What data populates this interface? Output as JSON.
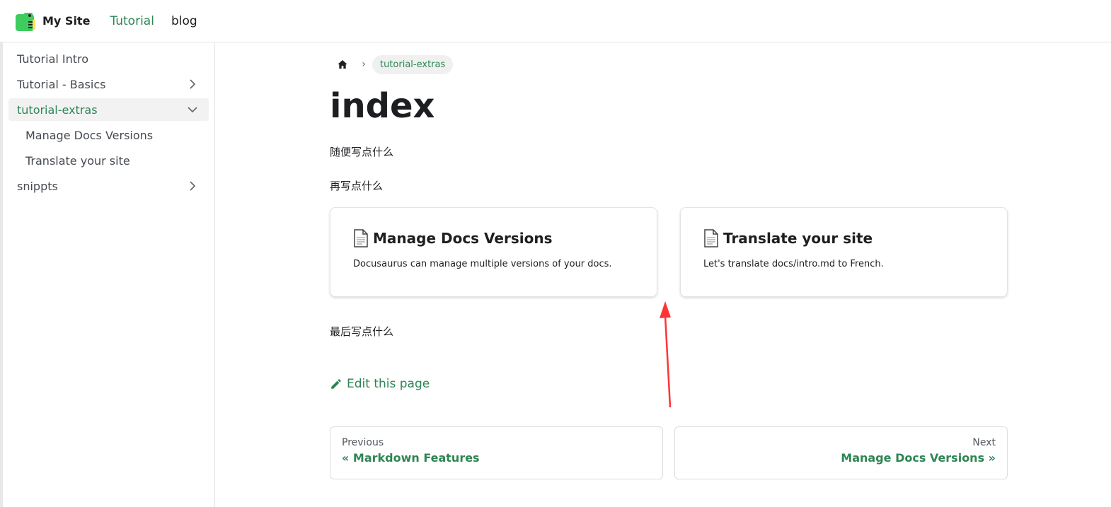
{
  "navbar": {
    "site_title": "My Site",
    "links": [
      {
        "label": "Tutorial",
        "active": true
      },
      {
        "label": "blog",
        "active": false
      }
    ]
  },
  "sidebar": {
    "items": [
      {
        "label": "Tutorial Intro",
        "has_chevron": false
      },
      {
        "label": "Tutorial - Basics",
        "has_chevron": true,
        "chevron": "chevron-right-icon"
      },
      {
        "label": "tutorial-extras",
        "active": true,
        "has_chevron": true,
        "chevron": "chevron-down-icon"
      },
      {
        "label": "Manage Docs Versions",
        "child": true
      },
      {
        "label": "Translate your site",
        "child": true
      },
      {
        "label": "snippts",
        "has_chevron": true,
        "chevron": "chevron-right-icon"
      }
    ]
  },
  "breadcrumb": {
    "home_icon": "home-icon",
    "current": "tutorial-extras"
  },
  "main": {
    "title": "index",
    "para1": "随便写点什么",
    "para2": "再写点什么",
    "para3": "最后写点什么",
    "cards": [
      {
        "icon": "document-icon",
        "title": "Manage Docs Versions",
        "desc": "Docusaurus can manage multiple versions of your docs."
      },
      {
        "icon": "document-icon",
        "title": "Translate your site",
        "desc": "Let's translate docs/intro.md to French."
      }
    ],
    "edit_link": "Edit this page"
  },
  "pager": {
    "prev_sub": "Previous",
    "prev_label": "« Markdown Features",
    "next_sub": "Next",
    "next_label": "Manage Docs Versions »"
  },
  "colors": {
    "primary": "#2e8555",
    "annotation_arrow": "#ff3333"
  }
}
